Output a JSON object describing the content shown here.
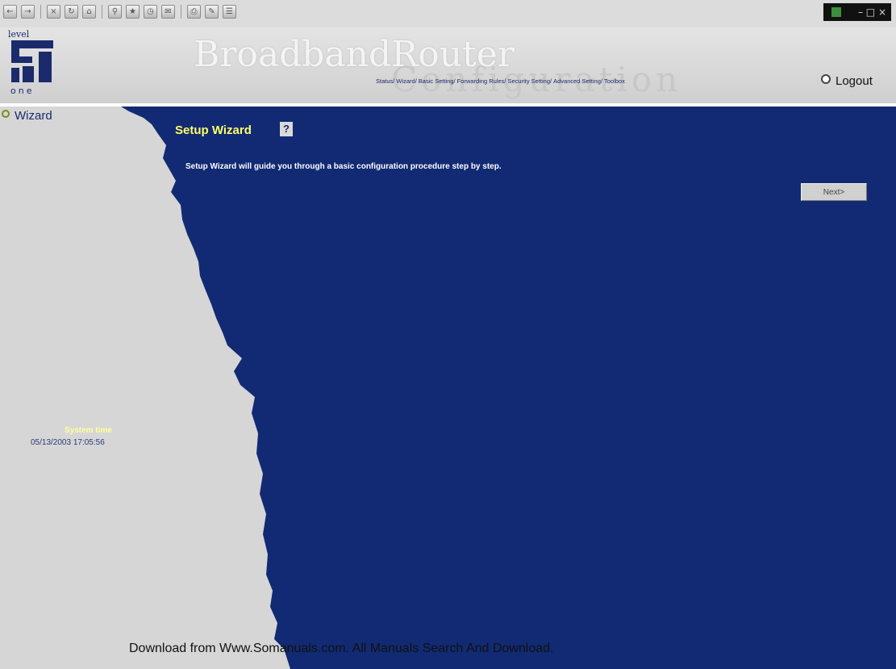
{
  "toolbar": {
    "icons": [
      "back-icon",
      "forward-icon",
      "stop-icon",
      "refresh-icon",
      "home-icon",
      "search-icon",
      "favorites-icon",
      "history-icon",
      "mail-icon",
      "print-icon",
      "edit-icon",
      "discuss-icon"
    ]
  },
  "header": {
    "logo_top": "level",
    "logo_bottom": "one",
    "brand": "BroadbandRouter",
    "subtitle": "Configuration",
    "nav": [
      "Status/",
      "Wizard/",
      "Basic Setting/",
      "Forwarding Rules/",
      "Security Setting/",
      "Advanced Setting/",
      "Toolbox"
    ],
    "logout_label": "Logout"
  },
  "sidebar": {
    "wizard_label": "Wizard",
    "system_time_label": "System time",
    "system_time_value": "05/13/2003 17:05:56"
  },
  "main": {
    "title": "Setup Wizard",
    "help_label": "?",
    "description": "Setup Wizard will guide you through a basic configuration procedure step by step.",
    "next_label": "Next>"
  },
  "footer": {
    "text": "Download from Www.Somanuals.com. All Manuals Search And Download."
  },
  "colors": {
    "main_bg": "#112a73",
    "side_bg": "#d6d6d6",
    "title": "#ffff66",
    "nav_text": "#1b2a6b"
  }
}
